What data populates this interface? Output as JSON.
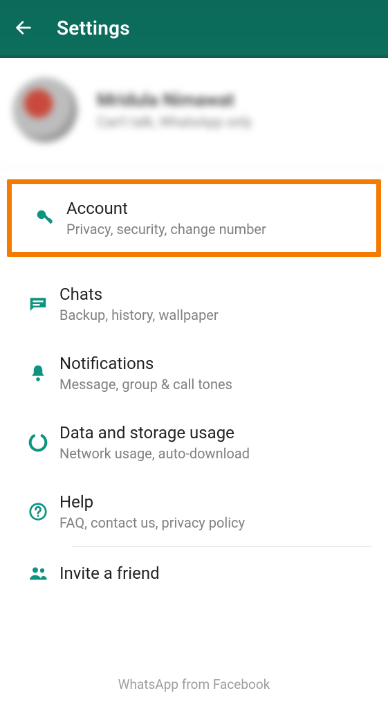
{
  "appbar": {
    "title": "Settings"
  },
  "profile": {
    "name": "Mridula Nimawat",
    "status": "Can't talk, WhatsApp only"
  },
  "items": [
    {
      "title": "Account",
      "subtitle": "Privacy, security, change number"
    },
    {
      "title": "Chats",
      "subtitle": "Backup, history, wallpaper"
    },
    {
      "title": "Notifications",
      "subtitle": "Message, group & call tones"
    },
    {
      "title": "Data and storage usage",
      "subtitle": "Network usage, auto-download"
    },
    {
      "title": "Help",
      "subtitle": "FAQ, contact us, privacy policy"
    },
    {
      "title": "Invite a friend",
      "subtitle": ""
    }
  ],
  "footer": "WhatsApp from Facebook",
  "colors": {
    "accent": "#0d7f6e",
    "appbar": "#0d6e5e",
    "highlight": "#f47b00"
  }
}
